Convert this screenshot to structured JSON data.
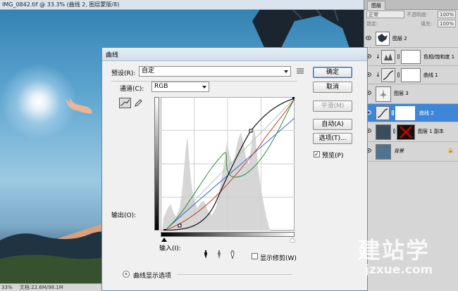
{
  "document": {
    "title": "IMG_0842.tif @ 33.3% (曲线 2, 图层蒙版/8)",
    "status": {
      "zoom": "33%",
      "doc_size": "文档:22.6M/98.1M"
    }
  },
  "layers_panel": {
    "tab_label": "图层",
    "blend_mode": "正常",
    "opacity_label": "不透明度:",
    "opacity_value": "100%",
    "lock_label": "锁定:",
    "fill_label": "填充:",
    "fill_value": "100%",
    "layers": [
      {
        "name": "图层 2",
        "selected": false
      },
      {
        "name": "色相/饱和度 1",
        "selected": false
      },
      {
        "name": "曲线 1",
        "selected": false
      },
      {
        "name": "图层 3",
        "selected": false
      },
      {
        "name": "曲线 2",
        "selected": true
      },
      {
        "name": "图层 1 副本",
        "selected": false
      },
      {
        "name": "背景",
        "selected": false
      }
    ]
  },
  "curves_dialog": {
    "title": "曲线",
    "preset_label": "预设(R):",
    "preset_value": "自定",
    "channel_label": "通道(C):",
    "channel_value": "RGB",
    "output_label": "输出(O):",
    "input_label": "输入(I):",
    "show_clipping_label": "显示修剪(W)",
    "show_clipping_checked": false,
    "display_options_label": "曲线显示选项",
    "buttons": {
      "ok": "确定",
      "cancel": "取消",
      "smooth": "平滑(M)",
      "auto": "自动(A)",
      "options": "选项(T)..."
    },
    "preview_label": "预览(P)",
    "preview_checked": true
  },
  "watermark": {
    "text": "建站学",
    "url": "jzxue.com"
  }
}
